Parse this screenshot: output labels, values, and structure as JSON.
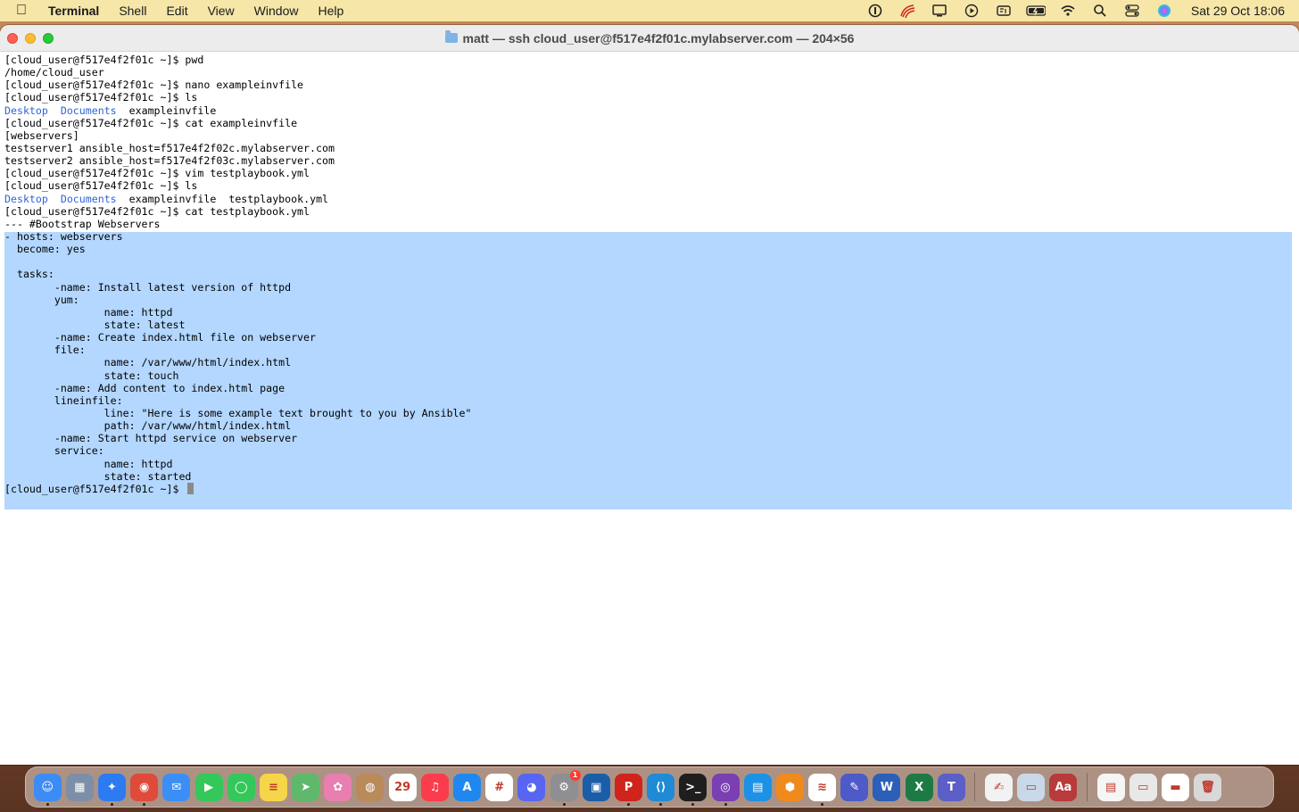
{
  "menubar": {
    "app_name": "Terminal",
    "menus": [
      "Shell",
      "Edit",
      "View",
      "Window",
      "Help"
    ],
    "clock": "Sat 29 Oct  18:06"
  },
  "window": {
    "title": "matt — ssh cloud_user@f517e4f2f01c.mylabserver.com — 204×56"
  },
  "terminal": {
    "prompt": "[cloud_user@f517e4f2f01c ~]$ ",
    "lines": [
      "[cloud_user@f517e4f2f01c ~]$ pwd",
      "/home/cloud_user",
      "[cloud_user@f517e4f2f01c ~]$ nano exampleinvfile",
      "[cloud_user@f517e4f2f01c ~]$ ls",
      "LS1",
      "[cloud_user@f517e4f2f01c ~]$ cat exampleinvfile",
      "[webservers]",
      "testserver1 ansible_host=f517e4f2f02c.mylabserver.com",
      "testserver2 ansible_host=f517e4f2f03c.mylabserver.com",
      "[cloud_user@f517e4f2f01c ~]$ vim testplaybook.yml",
      "[cloud_user@f517e4f2f01c ~]$ ls",
      "LS2",
      "[cloud_user@f517e4f2f01c ~]$ cat testplaybook.yml",
      "--- #Bootstrap Webservers",
      "- hosts: webservers",
      "  become: yes",
      "",
      "  tasks:",
      "        -name: Install latest version of httpd",
      "        yum:",
      "                name: httpd",
      "                state: latest",
      "        -name: Create index.html file on webserver",
      "        file:",
      "                name: /var/www/html/index.html",
      "                state: touch",
      "        -name: Add content to index.html page",
      "        lineinfile:",
      "                line: \"Here is some example text brought to you by Ansible\"",
      "                path: /var/www/html/index.html",
      "        -name: Start httpd service on webserver",
      "        service:",
      "                name: httpd",
      "                state: started"
    ],
    "ls1": {
      "dirs": [
        "Desktop",
        "Documents"
      ],
      "files": [
        "exampleinvfile"
      ]
    },
    "ls2": {
      "dirs": [
        "Desktop",
        "Documents"
      ],
      "files": [
        "exampleinvfile",
        "testplaybook.yml"
      ]
    },
    "colors": {
      "directory": "#2f64d8",
      "selection": "#b3d7ff"
    }
  },
  "dock": {
    "apps": [
      {
        "name": "finder",
        "color": "#3d8bf5",
        "glyph": "☺",
        "running": true
      },
      {
        "name": "launchpad",
        "color": "#7d8fa8",
        "glyph": "▦",
        "running": false
      },
      {
        "name": "safari",
        "color": "#2d7bf0",
        "glyph": "✦",
        "running": true
      },
      {
        "name": "chrome",
        "color": "#e04a3a",
        "glyph": "◉",
        "running": true
      },
      {
        "name": "mail",
        "color": "#3a8ef6",
        "glyph": "✉",
        "running": false
      },
      {
        "name": "facetime",
        "color": "#34c759",
        "glyph": "▶",
        "running": false
      },
      {
        "name": "messages",
        "color": "#34c759",
        "glyph": "◯",
        "running": false
      },
      {
        "name": "notes",
        "color": "#f5d54a",
        "glyph": "≡",
        "running": false
      },
      {
        "name": "maps",
        "color": "#5fb86b",
        "glyph": "➤",
        "running": false
      },
      {
        "name": "photos",
        "color": "#e87fb0",
        "glyph": "✿",
        "running": false
      },
      {
        "name": "contacts",
        "color": "#b98a5a",
        "glyph": "◍",
        "running": false
      },
      {
        "name": "calendar",
        "color": "#ffffff",
        "glyph": "29",
        "running": false
      },
      {
        "name": "music",
        "color": "#fa3c4c",
        "glyph": "♫",
        "running": false
      },
      {
        "name": "app-store",
        "color": "#1e88f0",
        "glyph": "A",
        "running": false
      },
      {
        "name": "slack",
        "color": "#ffffff",
        "glyph": "#",
        "running": false
      },
      {
        "name": "discord",
        "color": "#5865f2",
        "glyph": "◕",
        "running": false
      },
      {
        "name": "system-preferences",
        "color": "#8e8e93",
        "glyph": "⚙",
        "running": true,
        "badge": "1"
      },
      {
        "name": "virtualbox",
        "color": "#1b5ea8",
        "glyph": "▣",
        "running": false
      },
      {
        "name": "parallels",
        "color": "#d0231c",
        "glyph": "P",
        "running": true
      },
      {
        "name": "vscode",
        "color": "#1f8ad6",
        "glyph": "⟨⟩",
        "running": true
      },
      {
        "name": "terminal",
        "color": "#1e1e1e",
        "glyph": ">_",
        "running": true
      },
      {
        "name": "github-desktop",
        "color": "#7a3fb2",
        "glyph": "◎",
        "running": true
      },
      {
        "name": "docker",
        "color": "#1d91e6",
        "glyph": "▤",
        "running": false
      },
      {
        "name": "sourcetree",
        "color": "#f08a1c",
        "glyph": "⬢",
        "running": false
      },
      {
        "name": "app-red-lines",
        "color": "#ffffff",
        "glyph": "≋",
        "running": true
      },
      {
        "name": "pixelmator",
        "color": "#4e5ac8",
        "glyph": "✎",
        "running": false
      },
      {
        "name": "word",
        "color": "#2b5fb8",
        "glyph": "W",
        "running": false
      },
      {
        "name": "excel",
        "color": "#1e7a45",
        "glyph": "X",
        "running": false
      },
      {
        "name": "teams",
        "color": "#5b5fc7",
        "glyph": "T",
        "running": false
      },
      {
        "name": "textedit",
        "color": "#f2f2f2",
        "glyph": "✍",
        "running": false
      },
      {
        "name": "preview",
        "color": "#c9d8e8",
        "glyph": "▭",
        "running": false
      },
      {
        "name": "dictionary",
        "color": "#b83a3a",
        "glyph": "Aa",
        "running": false
      },
      {
        "name": "downloads-stack",
        "color": "#f5f5f5",
        "glyph": "▤",
        "running": false
      },
      {
        "name": "screenshot-stack",
        "color": "#e8e8e8",
        "glyph": "▭",
        "running": false
      },
      {
        "name": "folder-stack",
        "color": "#ffffff",
        "glyph": "▬",
        "running": false
      },
      {
        "name": "trash",
        "color": "#d8d8d8",
        "glyph": "🗑",
        "running": false
      }
    ]
  }
}
